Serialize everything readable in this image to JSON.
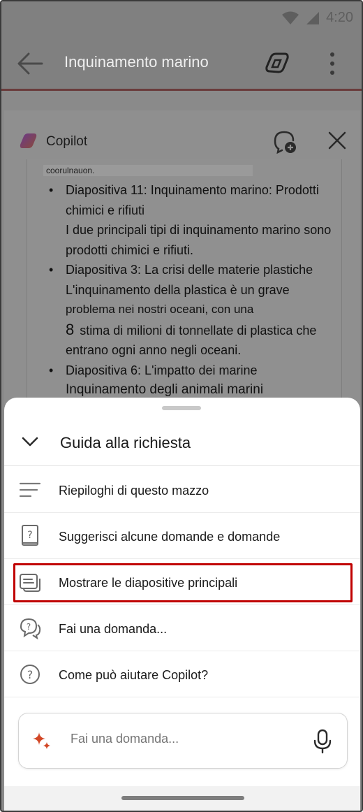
{
  "status": {
    "time": "4:20"
  },
  "appbar": {
    "title": "Inquinamento marino"
  },
  "copilot": {
    "title": "Copilot",
    "doc": {
      "cut_line": "coorulnauon.",
      "items": [
        {
          "head": "Diapositiva 11: Inquinamento marino: Prodotti chimici e rifiuti",
          "body": "I due principali tipi di inquinamento marino sono prodotti chimici e rifiuti."
        },
        {
          "head": "Diapositiva 3: La crisi delle materie plastiche",
          "body_a": "L'inquinamento della plastica è un grave",
          "body_b": "problema nei nostri oceani, con una",
          "body_num": "8",
          "body_c": "stima di milioni di tonnellate di plastica che entrano ogni anno negli oceani."
        },
        {
          "head": "Diapositiva 6: L'impatto dei marine",
          "body": "Inquinamento degli animali marini"
        }
      ]
    }
  },
  "sheet": {
    "title": "Guida alla richiesta",
    "items": [
      {
        "label": "Riepiloghi di questo mazzo",
        "icon": "lines-icon"
      },
      {
        "label": "Suggerisci alcune domande e domande",
        "icon": "question-book-icon"
      },
      {
        "label": "Mostrare le diapositive principali",
        "icon": "slides-icon"
      },
      {
        "label": "Fai una domanda...",
        "icon": "chat-question-icon"
      },
      {
        "label": "Come può aiutare Copilot?",
        "icon": "help-circle-icon"
      }
    ],
    "ask": {
      "placeholder": "Fai una domanda..."
    }
  },
  "colors": {
    "highlight": "#c00000",
    "scrim": "#8a8a8a",
    "sparkle": "#d24726"
  }
}
